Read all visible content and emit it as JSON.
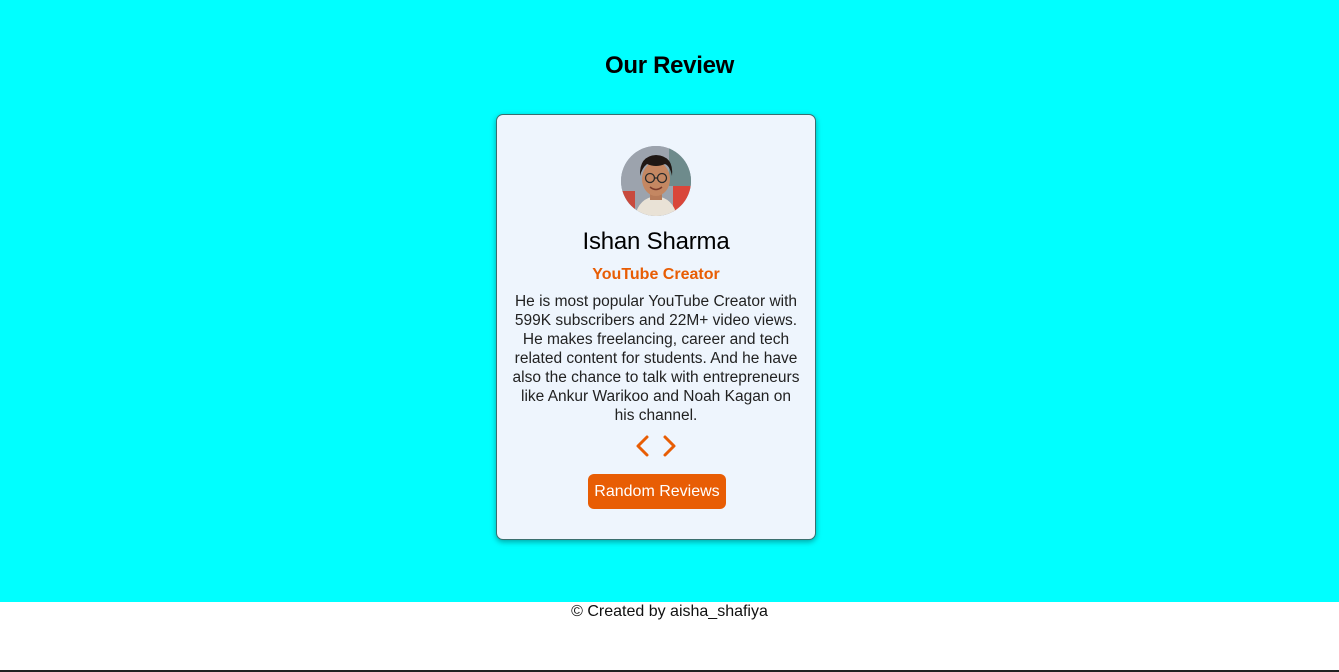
{
  "page": {
    "title": "Our Review",
    "background_color": "#00ffff"
  },
  "review": {
    "avatar_alt": "Ishan Sharma",
    "name": "Ishan Sharma",
    "job": "YouTube Creator",
    "info": "He is most popular YouTube Creator with 599K subscribers and 22M+ video views. He makes freelancing, career and tech related content for students. And he have also the chance to talk with entrepreneurs like Ankur Warikoo and Noah Kagan on his channel.",
    "prev_icon": "chevron-left-icon",
    "next_icon": "chevron-right-icon",
    "random_button_label": "Random Reviews",
    "accent_color": "#e85d04",
    "card_background": "#eef5fd"
  },
  "footer": {
    "text": "© Created by aisha_shafiya"
  }
}
